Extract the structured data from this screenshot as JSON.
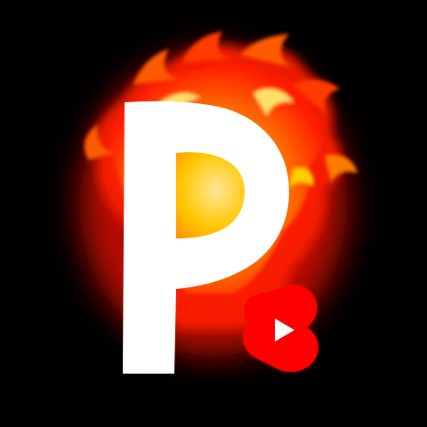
{
  "logo": {
    "letter": "P",
    "letter_color": "#ffffff",
    "glow_color": "#ff2a00",
    "flame_colors": [
      "#ff1a00",
      "#ff5a00",
      "#ff9a00",
      "#ffd000",
      "#fff2a0"
    ],
    "badge_icon": "youtube-shorts-icon",
    "badge_color": "#ff0000",
    "background_color": "#000000"
  }
}
